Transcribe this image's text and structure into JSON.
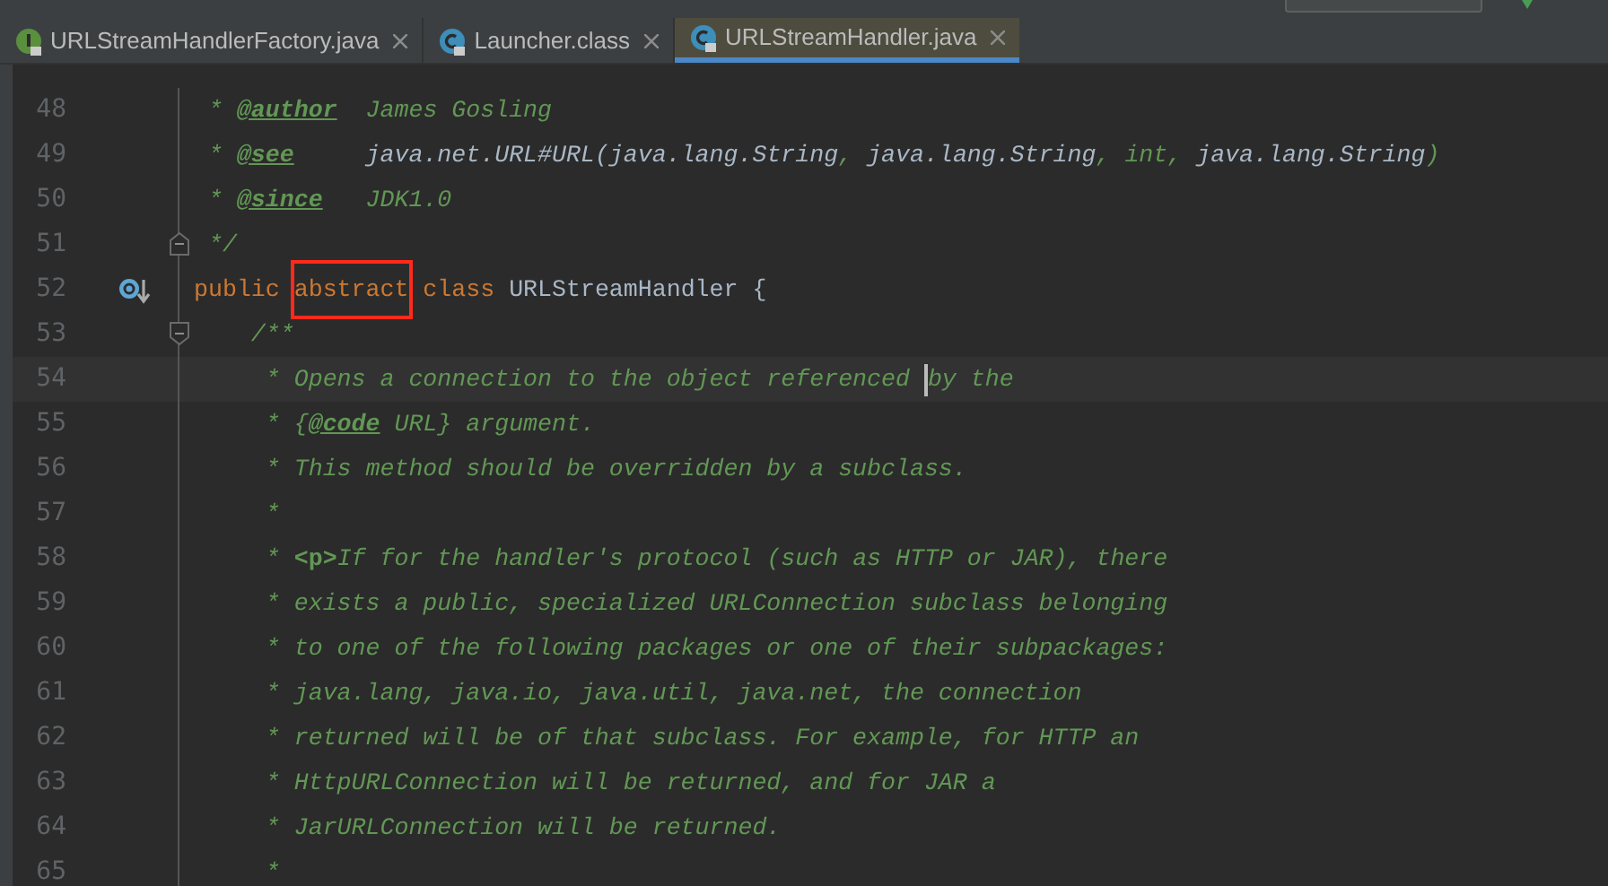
{
  "tabs": [
    {
      "label": "URLStreamHandlerFactory.java",
      "kind": "interface",
      "selected": false
    },
    {
      "label": "Launcher.class",
      "kind": "class",
      "selected": false
    },
    {
      "label": "URLStreamHandler.java",
      "kind": "class",
      "selected": true
    }
  ],
  "editor": {
    "lines": [
      {
        "number": "48",
        "tokens": [
          {
            "kind": "comment",
            "text": " * "
          },
          {
            "kind": "tag",
            "text": "@author"
          },
          {
            "kind": "comment",
            "text": "  James Gosling"
          }
        ]
      },
      {
        "number": "49",
        "tokens": [
          {
            "kind": "comment",
            "text": " * "
          },
          {
            "kind": "tag",
            "text": "@see"
          },
          {
            "kind": "ref",
            "text": "     java.net.URL#URL(java.lang.String"
          },
          {
            "kind": "comment",
            "text": ", "
          },
          {
            "kind": "ref",
            "text": "java.lang.String"
          },
          {
            "kind": "comment",
            "text": ", int, "
          },
          {
            "kind": "ref",
            "text": "java.lang.String"
          },
          {
            "kind": "comment",
            "text": ")"
          }
        ]
      },
      {
        "number": "50",
        "tokens": [
          {
            "kind": "comment",
            "text": " * "
          },
          {
            "kind": "tag",
            "text": "@since"
          },
          {
            "kind": "comment",
            "text": "   JDK1.0"
          }
        ]
      },
      {
        "number": "51",
        "fold_end": true,
        "tokens": [
          {
            "kind": "comment",
            "text": " */"
          }
        ]
      },
      {
        "number": "52",
        "overridden": true,
        "tokens": [
          {
            "kind": "keyword",
            "text": "public "
          },
          {
            "kind": "keyword",
            "text": "abstract",
            "boxed": true
          },
          {
            "kind": "keyword",
            "text": " class"
          },
          {
            "kind": "text",
            "text": " URLStreamHandler {"
          }
        ]
      },
      {
        "number": "53",
        "fold_start": true,
        "tokens": [
          {
            "kind": "comment",
            "text": "    /**"
          }
        ]
      },
      {
        "number": "54",
        "current": true,
        "tokens": [
          {
            "kind": "comment",
            "text": "     * Opens a connection to the object referenced "
          },
          {
            "kind": "comment",
            "text": "by the",
            "caret_before": true
          }
        ]
      },
      {
        "number": "55",
        "tokens": [
          {
            "kind": "comment",
            "text": "     * {"
          },
          {
            "kind": "tag",
            "text": "@code"
          },
          {
            "kind": "comment",
            "text": " URL} argument."
          }
        ]
      },
      {
        "number": "56",
        "tokens": [
          {
            "kind": "comment",
            "text": "     * This method should be overridden by a subclass."
          }
        ]
      },
      {
        "number": "57",
        "tokens": [
          {
            "kind": "comment",
            "text": "     *"
          }
        ]
      },
      {
        "number": "58",
        "tokens": [
          {
            "kind": "comment",
            "text": "     * "
          },
          {
            "kind": "html",
            "text": "<p>"
          },
          {
            "kind": "comment",
            "text": "If for the handler's protocol (such as HTTP or JAR), there"
          }
        ]
      },
      {
        "number": "59",
        "tokens": [
          {
            "kind": "comment",
            "text": "     * exists a public, specialized URLConnection subclass belonging"
          }
        ]
      },
      {
        "number": "60",
        "tokens": [
          {
            "kind": "comment",
            "text": "     * to one of the following packages or one of their subpackages:"
          }
        ]
      },
      {
        "number": "61",
        "tokens": [
          {
            "kind": "comment",
            "text": "     * java.lang, java.io, java.util, java.net, the connection"
          }
        ]
      },
      {
        "number": "62",
        "tokens": [
          {
            "kind": "comment",
            "text": "     * returned will be of that subclass. For example, for HTTP an"
          }
        ]
      },
      {
        "number": "63",
        "tokens": [
          {
            "kind": "comment",
            "text": "     * HttpURLConnection will be returned, and for JAR a"
          }
        ]
      },
      {
        "number": "64",
        "tokens": [
          {
            "kind": "comment",
            "text": "     * JarURLConnection will be returned."
          }
        ]
      },
      {
        "number": "65",
        "tokens": [
          {
            "kind": "comment",
            "text": "     *"
          }
        ]
      }
    ]
  }
}
